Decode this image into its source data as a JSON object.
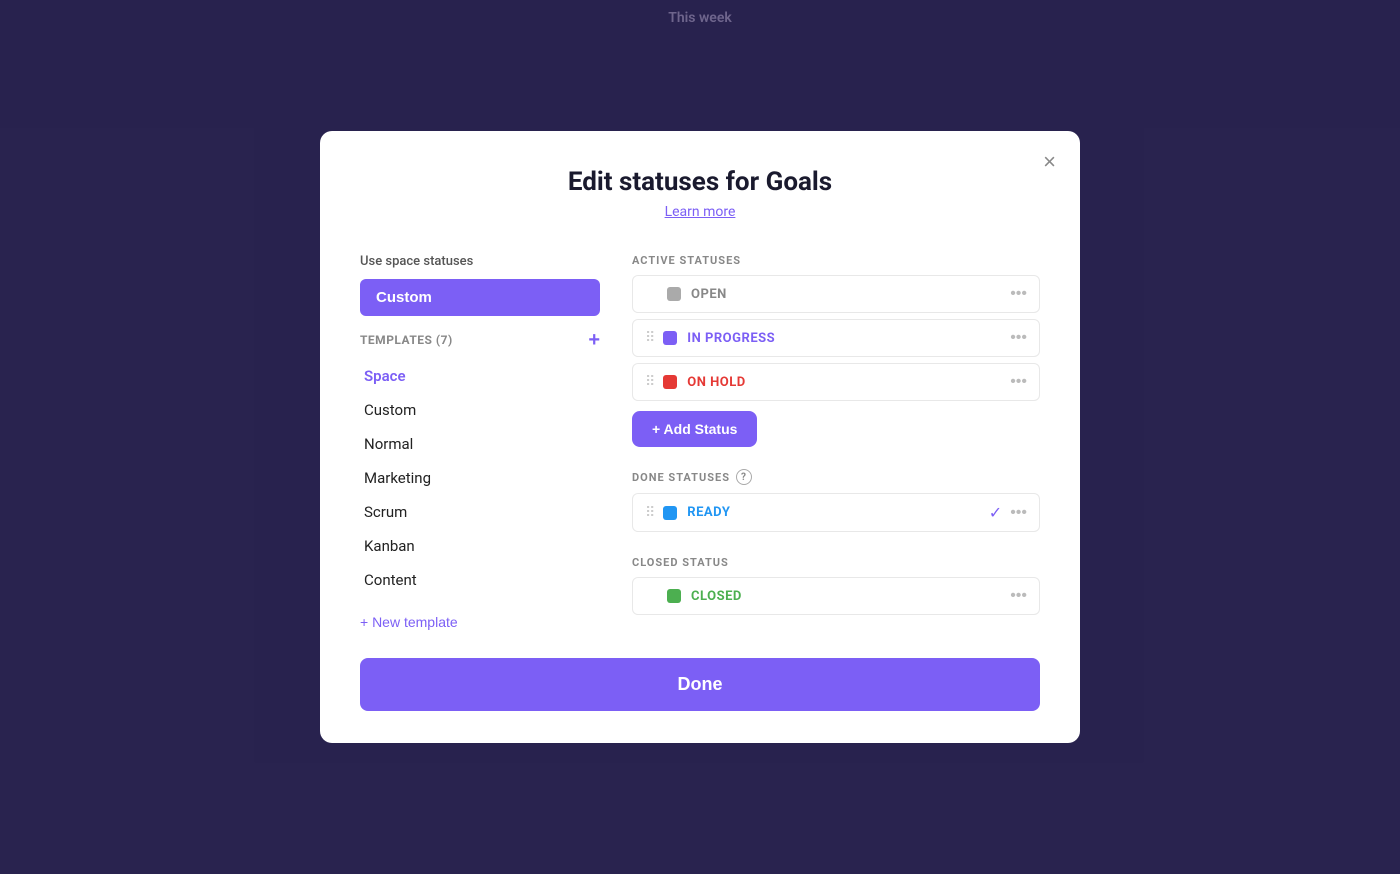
{
  "topbar": {
    "title": "This week"
  },
  "modal": {
    "title": "Edit statuses for Goals",
    "subtitle": "Learn more",
    "close_label": "×",
    "left": {
      "use_space_label": "Use space statuses",
      "custom_btn_label": "Custom",
      "templates_label": "TEMPLATES (7)",
      "templates_add_label": "+",
      "templates": [
        {
          "name": "Space",
          "active": true
        },
        {
          "name": "Custom",
          "active": false
        },
        {
          "name": "Normal",
          "active": false
        },
        {
          "name": "Marketing",
          "active": false
        },
        {
          "name": "Scrum",
          "active": false
        },
        {
          "name": "Kanban",
          "active": false
        },
        {
          "name": "Content",
          "active": false
        }
      ],
      "new_template_label": "+ New template"
    },
    "right": {
      "active_statuses_label": "ACTIVE STATUSES",
      "active_statuses": [
        {
          "name": "OPEN",
          "color": "gray",
          "has_drag": false
        },
        {
          "name": "IN PROGRESS",
          "color": "purple",
          "has_drag": true
        },
        {
          "name": "ON HOLD",
          "color": "red",
          "has_drag": true
        }
      ],
      "add_status_label": "+ Add Status",
      "done_statuses_label": "DONE STATUSES",
      "done_statuses": [
        {
          "name": "READY",
          "color": "blue",
          "has_drag": true,
          "has_check": true
        }
      ],
      "closed_status_label": "CLOSED STATUS",
      "closed_statuses": [
        {
          "name": "CLOSED",
          "color": "green",
          "has_drag": false
        }
      ]
    },
    "done_label": "Done"
  }
}
